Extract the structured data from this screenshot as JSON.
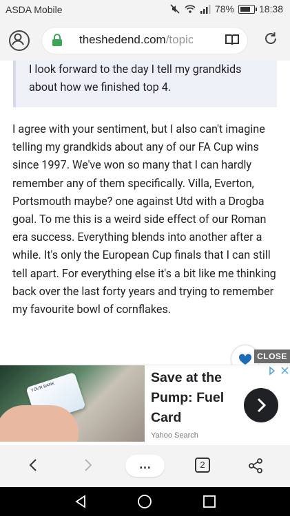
{
  "status_bar": {
    "carrier": "ASDA Mobile",
    "battery": "78%",
    "time": "18:38"
  },
  "browser": {
    "url_domain": "theshedend.com",
    "url_path": "/topic/",
    "tab_count": "2",
    "menu_label": "…"
  },
  "quote": {
    "text": "I look forward to the day I tell my grandkids about how we finished top 4."
  },
  "post": {
    "text": "I agree with your sentiment, but I also can't imagine telling my grandkids about any of our FA Cup wins since 1997. We've won so many that I can hardly remember any of them specifically. Villa, Everton, Portsmouth maybe? one against Utd with a Drogba goal. To me this is a weird side effect of our Roman era success. Everything blends into another after a while. It's only the European Cup finals that I can still tell apart. For everything else it's a bit like me thinking back over the last forty years and trying to remember my favourite bowl of cornflakes."
  },
  "ad": {
    "close_label": "CLOSE",
    "headline": "Save at the Pump: Fuel Card",
    "source": "Yahoo Search",
    "card_brand": "YOUR BANK"
  },
  "colors": {
    "lock_green": "#3aa757",
    "quote_bg": "#eef0f8",
    "toolbar_bg": "#f3f3f3",
    "nav_bg": "#000000"
  }
}
